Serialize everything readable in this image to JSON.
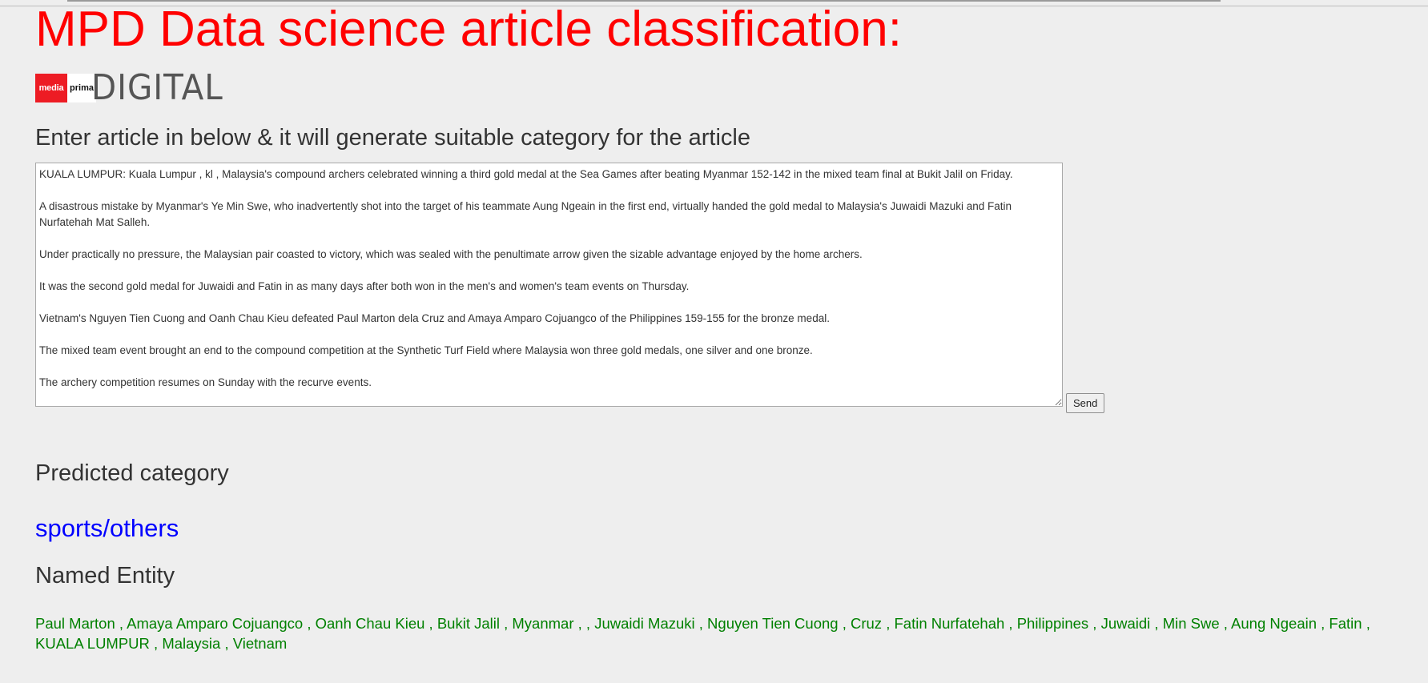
{
  "page": {
    "title": "MPD Data science article classification:",
    "logo": {
      "media_text": "media",
      "prima_text": "prima",
      "digital_text": "DIGITAL",
      "brand_color": "#ed1c24"
    },
    "prompt": "Enter article in below & it will generate suitable category for the article",
    "article_text": "KUALA LUMPUR: Kuala Lumpur , kl , Malaysia's compound archers celebrated winning a third gold medal at the Sea Games after beating Myanmar 152-142 in the mixed team final at Bukit Jalil on Friday.\n\nA disastrous mistake by Myanmar's Ye Min Swe, who inadvertently shot into the target of his teammate Aung Ngeain in the first end, virtually handed the gold medal to Malaysia's Juwaidi Mazuki and Fatin Nurfatehah Mat Salleh.\n\nUnder practically no pressure, the Malaysian pair coasted to victory, which was sealed with the penultimate arrow given the sizable advantage enjoyed by the home archers.\n\nIt was the second gold medal for Juwaidi and Fatin in as many days after both won in the men's and women's team events on Thursday.\n\nVietnam's Nguyen Tien Cuong and Oanh Chau Kieu defeated Paul Marton dela Cruz and Amaya Amparo Cojuangco of the Philippines 159-155 for the bronze medal.\n\nThe mixed team event brought an end to the compound competition at the Synthetic Turf Field where Malaysia won three gold medals, one silver and one bronze.\n\nThe archery competition resumes on Sunday with the recurve events.",
    "send_label": "Send",
    "predicted_heading": "Predicted category",
    "predicted_category": "sports/others",
    "entity_heading": "Named Entity",
    "entities_text": "Paul Marton , Amaya Amparo Cojuangco , Oanh Chau Kieu , Bukit Jalil , Myanmar , , Juwaidi Mazuki , Nguyen Tien Cuong , Cruz , Fatin Nurfatehah , Philippines , Juwaidi , Min Swe , Aung Ngeain , Fatin , KUALA LUMPUR , Malaysia , Vietnam",
    "colors": {
      "title": "#ff0000",
      "category": "#0000ff",
      "entities": "#008000",
      "background": "#eeeeee"
    }
  }
}
